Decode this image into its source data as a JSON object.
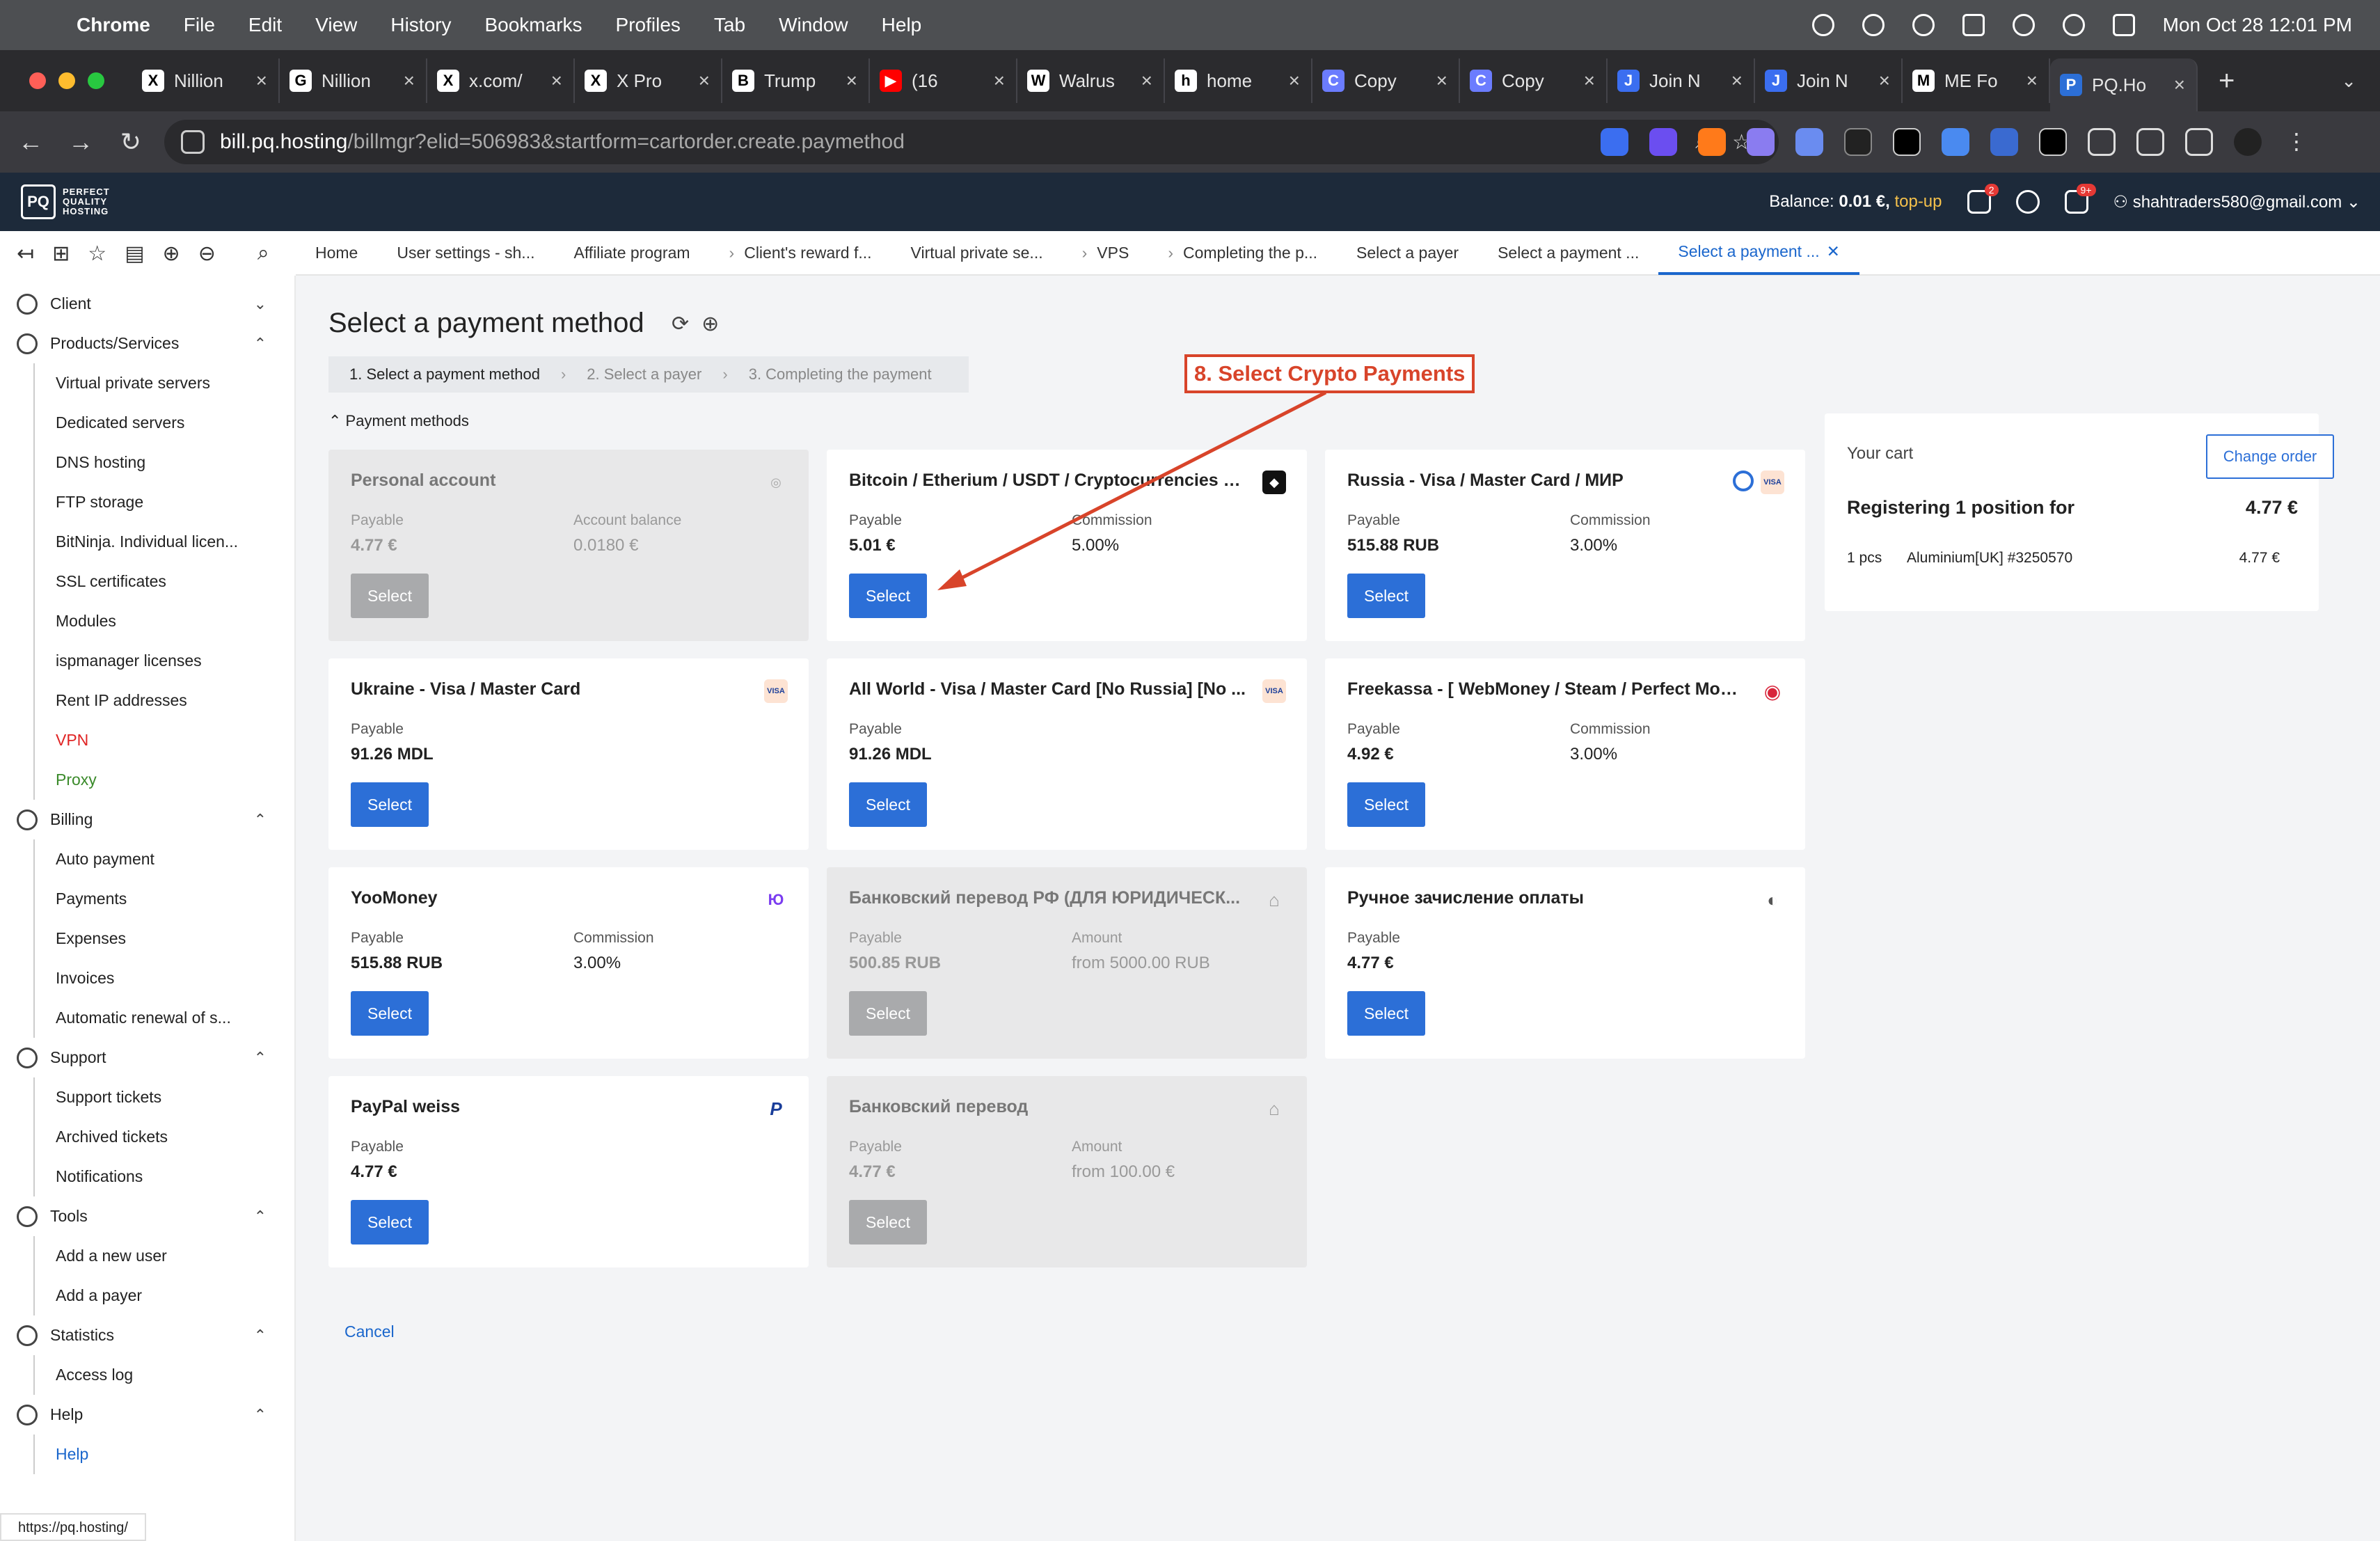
{
  "menubar": {
    "app": "Chrome",
    "items": [
      "File",
      "Edit",
      "View",
      "History",
      "Bookmarks",
      "Profiles",
      "Tab",
      "Window",
      "Help"
    ],
    "datetime": "Mon Oct 28  12:01 PM"
  },
  "tabs": [
    {
      "icon": "X",
      "label": "Nillion"
    },
    {
      "icon": "G",
      "label": "Nillion"
    },
    {
      "icon": "X",
      "label": "x.com/"
    },
    {
      "icon": "X",
      "label": "X Pro"
    },
    {
      "icon": "B",
      "label": "Trump"
    },
    {
      "icon": "▶",
      "label": "(16"
    },
    {
      "icon": "W",
      "label": "Walrus"
    },
    {
      "icon": "h",
      "label": "home"
    },
    {
      "icon": "C",
      "label": "Copy"
    },
    {
      "icon": "C",
      "label": "Copy"
    },
    {
      "icon": "J",
      "label": "Join N"
    },
    {
      "icon": "J",
      "label": "Join N"
    },
    {
      "icon": "M",
      "label": "ME Fo"
    },
    {
      "icon": "P",
      "label": "PQ.Ho"
    }
  ],
  "address": {
    "host": "bill.pq.hosting",
    "path": "/billmgr?elid=506983&startform=cartorder.create.paymethod"
  },
  "header": {
    "balance_label": "Balance:",
    "balance_value": "0.01 €,",
    "topup": "top-up",
    "cart_badge": "2",
    "mail_badge": "9+",
    "user": "shahtraders580@gmail.com"
  },
  "breadcrumbs": [
    "Home",
    "User settings - sh...",
    "Affiliate program",
    "Client's reward f...",
    "Virtual private se...",
    "VPS",
    "Completing the p...",
    "Select a payer",
    "Select a payment ...",
    "Select a payment ..."
  ],
  "sidebar": [
    {
      "group": "Client",
      "expanded": false,
      "items": []
    },
    {
      "group": "Products/Services",
      "expanded": true,
      "items": [
        "Virtual private servers",
        "Dedicated servers",
        "DNS hosting",
        "FTP storage",
        "BitNinja. Individual licen...",
        "SSL certificates",
        "Modules",
        "ispmanager licenses",
        "Rent IP addresses",
        "VPN",
        "Proxy"
      ]
    },
    {
      "group": "Billing",
      "expanded": true,
      "items": [
        "Auto payment",
        "Payments",
        "Expenses",
        "Invoices",
        "Automatic renewal of s..."
      ]
    },
    {
      "group": "Support",
      "expanded": true,
      "items": [
        "Support tickets",
        "Archived tickets",
        "Notifications"
      ]
    },
    {
      "group": "Tools",
      "expanded": true,
      "items": [
        "Add a new user",
        "Add a payer"
      ]
    },
    {
      "group": "Statistics",
      "expanded": true,
      "items": [
        "Access log"
      ]
    },
    {
      "group": "Help",
      "expanded": true,
      "items": [
        "Help"
      ]
    }
  ],
  "status_url": "https://pq.hosting/",
  "page": {
    "title": "Select a payment method",
    "steps": [
      "1. Select a payment method",
      "2. Select a payer",
      "3. Completing the payment"
    ],
    "section": "Payment methods",
    "cancel": "Cancel",
    "annotation": "8. Select Crypto Payments"
  },
  "cards": [
    {
      "name": "Personal account",
      "disabled": true,
      "l1": "Payable",
      "v1": "4.77 €",
      "l2": "Account balance",
      "v2": "0.0180 €",
      "icon": "◎",
      "btn": "Select"
    },
    {
      "name": "Bitcoin / Etherium / USDT / Cryptocurrencies - ...",
      "disabled": false,
      "l1": "Payable",
      "v1": "5.01 €",
      "l2": "Commission",
      "v2": "5.00%",
      "icon": "◆",
      "btn": "Select"
    },
    {
      "name": "Russia - Visa / Master Card / МИР",
      "disabled": false,
      "l1": "Payable",
      "v1": "515.88 RUB",
      "l2": "Commission",
      "v2": "3.00%",
      "icon": "VISA",
      "btn": "Select"
    },
    {
      "name": "Ukraine - Visa / Master Card",
      "disabled": false,
      "l1": "Payable",
      "v1": "91.26 MDL",
      "l2": "",
      "v2": "",
      "icon": "VISA",
      "btn": "Select"
    },
    {
      "name": "All World - Visa / Master Card [No Russia] [No ...",
      "disabled": false,
      "l1": "Payable",
      "v1": "91.26 MDL",
      "l2": "",
      "v2": "",
      "icon": "VISA",
      "btn": "Select"
    },
    {
      "name": "Freekassa - [ WebMoney / Steam / Perfect Mon...",
      "disabled": false,
      "l1": "Payable",
      "v1": "4.92 €",
      "l2": "Commission",
      "v2": "3.00%",
      "icon": "◉",
      "btn": "Select"
    },
    {
      "name": "YooMoney",
      "disabled": false,
      "l1": "Payable",
      "v1": "515.88 RUB",
      "l2": "Commission",
      "v2": "3.00%",
      "icon": "Ю",
      "btn": "Select"
    },
    {
      "name": "Банковский перевод РФ (ДЛЯ ЮРИДИЧЕСК...",
      "disabled": true,
      "l1": "Payable",
      "v1": "500.85 RUB",
      "l2": "Amount",
      "v2": "from 5000.00 RUB",
      "icon": "⌂",
      "btn": "Select"
    },
    {
      "name": "Ручное зачисление оплаты",
      "disabled": false,
      "l1": "Payable",
      "v1": "4.77 €",
      "l2": "",
      "v2": "",
      "icon": "◐",
      "btn": "Select"
    },
    {
      "name": "PayPal weiss",
      "disabled": false,
      "l1": "Payable",
      "v1": "4.77 €",
      "l2": "",
      "v2": "",
      "icon": "P",
      "btn": "Select"
    },
    {
      "name": "Банковский перевод",
      "disabled": true,
      "l1": "Payable",
      "v1": "4.77 €",
      "l2": "Amount",
      "v2": "from 100.00 €",
      "icon": "⌂",
      "btn": "Select"
    }
  ],
  "cart": {
    "title": "Your cart",
    "change": "Change order",
    "registering": "Registering 1 position for",
    "registering_value": "4.77 €",
    "qty": "1 pcs",
    "item": "Aluminium[UK] #3250570",
    "item_value": "4.77 €"
  }
}
